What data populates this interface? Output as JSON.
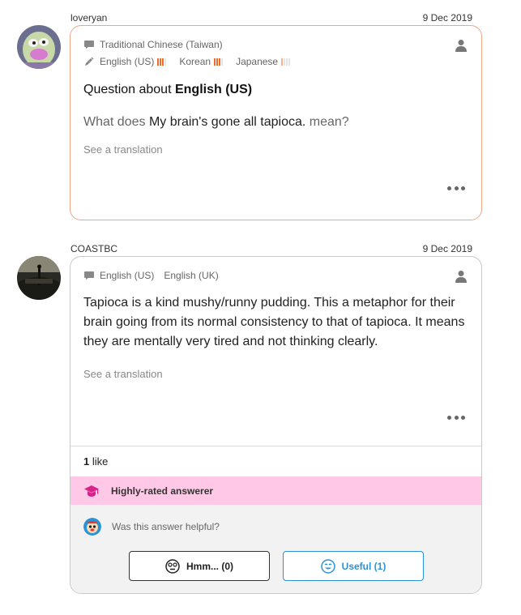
{
  "question": {
    "username": "loveryan",
    "date": "9 Dec 2019",
    "native_language": "Traditional Chinese (Taiwan)",
    "studying": [
      {
        "label": "English (US)",
        "level": 3,
        "style": "orange"
      },
      {
        "label": "Korean",
        "level": 3,
        "style": "orange"
      },
      {
        "label": "Japanese",
        "level": 1,
        "style": "light"
      }
    ],
    "title_prefix": "Question about ",
    "title_language": "English (US)",
    "text_prefix": "What does ",
    "text_phrase": "My brain's gone all tapioca.",
    "text_suffix": " mean?",
    "see_translation": "See a translation"
  },
  "answer": {
    "username": "COASTBC",
    "date": "9 Dec 2019",
    "languages": [
      "English (US)",
      "English (UK)"
    ],
    "text": "Tapioca is a kind mushy/runny pudding. This a metaphor for their brain going from its normal consistency to that of tapioca. It means they are mentally very tired and not thinking clearly.",
    "see_translation": "See a translation",
    "likes_count": "1",
    "likes_label": " like",
    "badge": "Highly-rated answerer",
    "helpful_prompt": "Was this answer helpful?",
    "hmm_label": "Hmm... (0)",
    "useful_label": "Useful (1)"
  },
  "colors": {
    "question_border": "#f0a585",
    "level_on": "#f06a2a",
    "badge_bg": "#ffc8e6",
    "useful_blue": "#2a93d5"
  },
  "icons": {
    "native_language_icon": "speech-bubble-icon",
    "studying_icon": "pencil-icon",
    "user_icon": "person-icon",
    "more_icon": "ellipsis-icon",
    "badge_icon": "graduation-cap-icon"
  }
}
